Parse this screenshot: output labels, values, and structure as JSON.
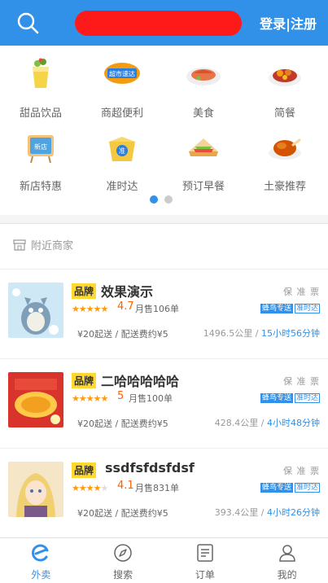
{
  "header": {
    "login_label": "登录|注册"
  },
  "categories": [
    {
      "label": "甜品饮品",
      "icon": "drink-icon"
    },
    {
      "label": "商超便利",
      "icon": "supermarket-icon"
    },
    {
      "label": "美食",
      "icon": "food-icon"
    },
    {
      "label": "简餐",
      "icon": "meal-icon"
    },
    {
      "label": "新店特惠",
      "icon": "new-store-icon"
    },
    {
      "label": "准时达",
      "icon": "ontime-icon"
    },
    {
      "label": "预订早餐",
      "icon": "breakfast-icon"
    },
    {
      "label": "土豪推荐",
      "icon": "chicken-icon"
    }
  ],
  "supermarket_badge": "超市速达",
  "new_store_badge": "新店",
  "ontime_badge": "准",
  "nearby": {
    "title": "附近商家",
    "shops": [
      {
        "brand": "品牌",
        "name": "效果演示",
        "tags": "保 准 票",
        "rating": "4.7",
        "sales": "月售106单",
        "fengniao": "蜂鸟专送",
        "zhunshi": "准时达",
        "fee": "¥20起送 / 配送费约¥5",
        "distance": "1496.5公里 / ",
        "time": "15小时56分钟",
        "stars": 5
      },
      {
        "brand": "品牌",
        "name": "二哈哈哈哈哈",
        "tags": "保 准 票",
        "rating": "5",
        "sales": "月售100单",
        "fengniao": "蜂鸟专送",
        "zhunshi": "准时达",
        "fee": "¥20起送 / 配送费约¥5",
        "distance": "428.4公里 / ",
        "time": "4小时48分钟",
        "stars": 5
      },
      {
        "brand": "品牌",
        "name": "ssdfsfdsfdsf",
        "tags": "保 准 票",
        "rating": "4.1",
        "sales": "月售831单",
        "fengniao": "蜂鸟专送",
        "zhunshi": "准时达",
        "fee": "¥20起送 / 配送费约¥5",
        "distance": "393.4公里 / ",
        "time": "4小时26分钟",
        "stars": 4
      }
    ]
  },
  "tabbar": [
    {
      "label": "外卖",
      "icon": "takeout-icon",
      "active": true
    },
    {
      "label": "搜索",
      "icon": "compass-icon",
      "active": false
    },
    {
      "label": "订单",
      "icon": "order-icon",
      "active": false
    },
    {
      "label": "我的",
      "icon": "profile-icon",
      "active": false
    }
  ],
  "colors": {
    "primary": "#3190e8",
    "star": "#ff9a0d",
    "brand_badge": "#ffd930"
  }
}
